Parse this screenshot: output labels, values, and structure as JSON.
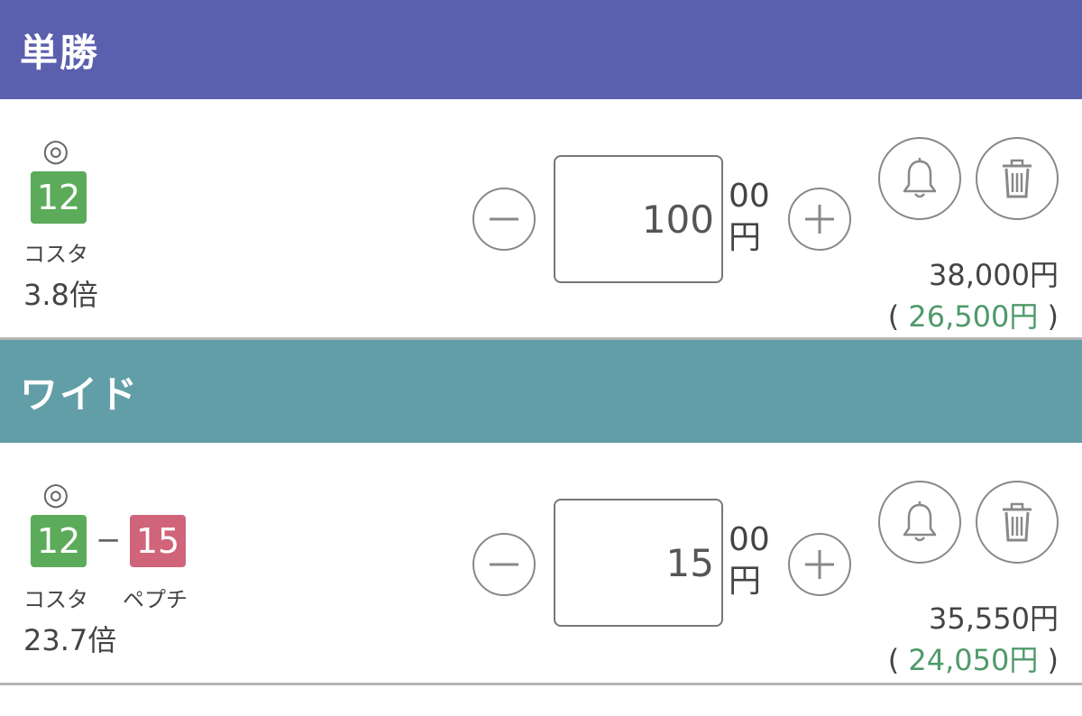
{
  "sections": [
    {
      "title": "単勝",
      "mark": "◎",
      "horses": [
        {
          "number": "12",
          "color": "#5cab5a",
          "name": "コスタ"
        }
      ],
      "dash": "",
      "odds": "3.8倍",
      "stake": "100",
      "unit_top": "00",
      "unit_bottom": "円",
      "minus": "−",
      "plus": "+",
      "payout": "38,000円",
      "refund_open": "(",
      "refund_amount": "26,500円",
      "refund_close": ")",
      "icons": [
        "bell-icon",
        "trash-icon"
      ]
    },
    {
      "title": "ワイド",
      "mark": "◎",
      "horses": [
        {
          "number": "12",
          "color": "#5cab5a",
          "name": "コスタ"
        },
        {
          "number": "15",
          "color": "#d0647a",
          "name": "ペプチ"
        }
      ],
      "dash": "−",
      "odds": "23.7倍",
      "stake": "15",
      "unit_top": "00",
      "unit_bottom": "円",
      "minus": "−",
      "plus": "+",
      "payout": "35,550円",
      "refund_open": "(",
      "refund_amount": "24,050円",
      "refund_close": ")",
      "icons": [
        "bell-icon",
        "trash-icon"
      ]
    }
  ]
}
